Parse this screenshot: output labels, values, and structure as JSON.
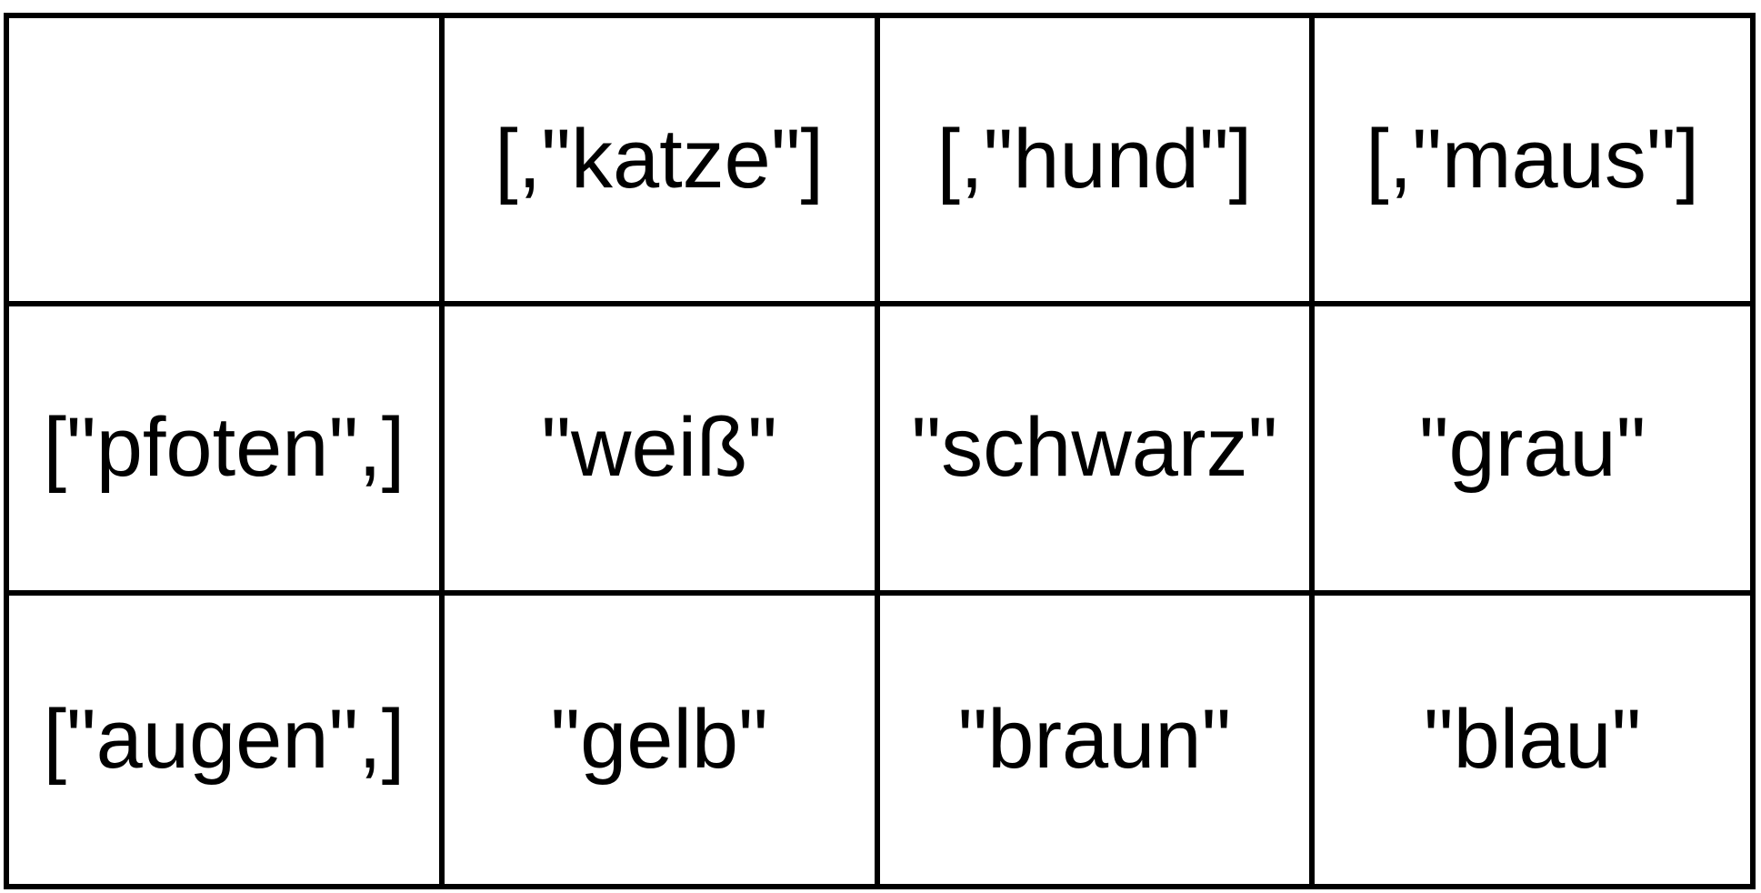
{
  "table": {
    "corner": "",
    "column_headers": [
      "[,\"katze\"]",
      "[,\"hund\"]",
      "[,\"maus\"]"
    ],
    "rows": [
      {
        "header": "[\"pfoten\",]",
        "cells": [
          "\"weiß\"",
          "\"schwarz\"",
          "\"grau\""
        ]
      },
      {
        "header": "[\"augen\",]",
        "cells": [
          "\"gelb\"",
          "\"braun\"",
          "\"blau\""
        ]
      }
    ]
  }
}
